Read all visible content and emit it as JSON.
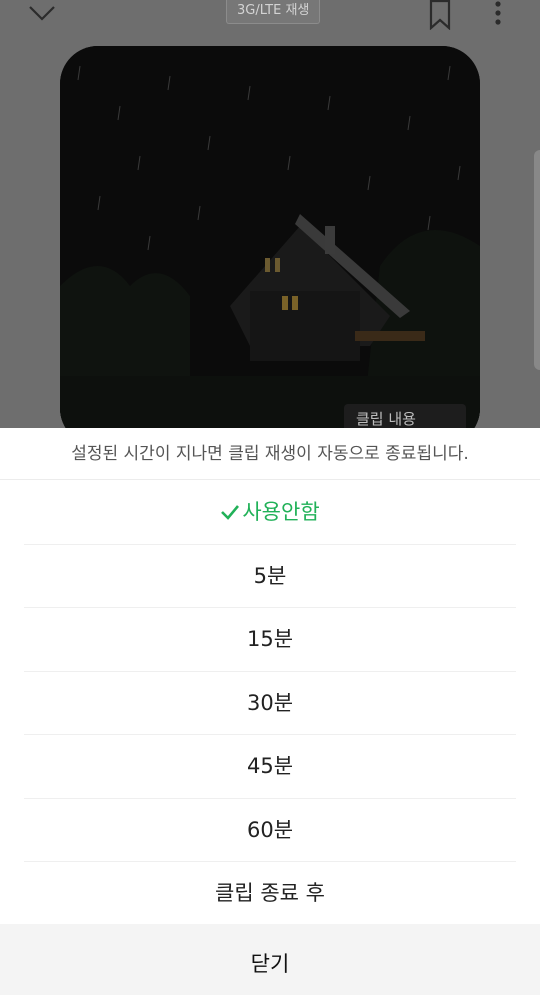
{
  "header": {
    "network_badge": "3G/LTE 재생",
    "back_icon": "chevron-down-icon",
    "bookmark_icon": "bookmark-icon",
    "more_icon": "more-vertical-icon"
  },
  "player": {
    "clip_button_label": "클립 내용"
  },
  "sheet": {
    "description": "설정된 시간이 지나면 클립 재생이 자동으로 종료됩니다.",
    "options": [
      {
        "label": "사용안함",
        "selected": true
      },
      {
        "label": "5분",
        "selected": false
      },
      {
        "label": "15분",
        "selected": false
      },
      {
        "label": "30분",
        "selected": false
      },
      {
        "label": "45분",
        "selected": false
      },
      {
        "label": "60분",
        "selected": false
      },
      {
        "label": "클립 종료 후",
        "selected": false
      }
    ],
    "close_label": "닫기"
  },
  "colors": {
    "accent": "#21b158",
    "dim_overlay": "#6b6b6b"
  }
}
